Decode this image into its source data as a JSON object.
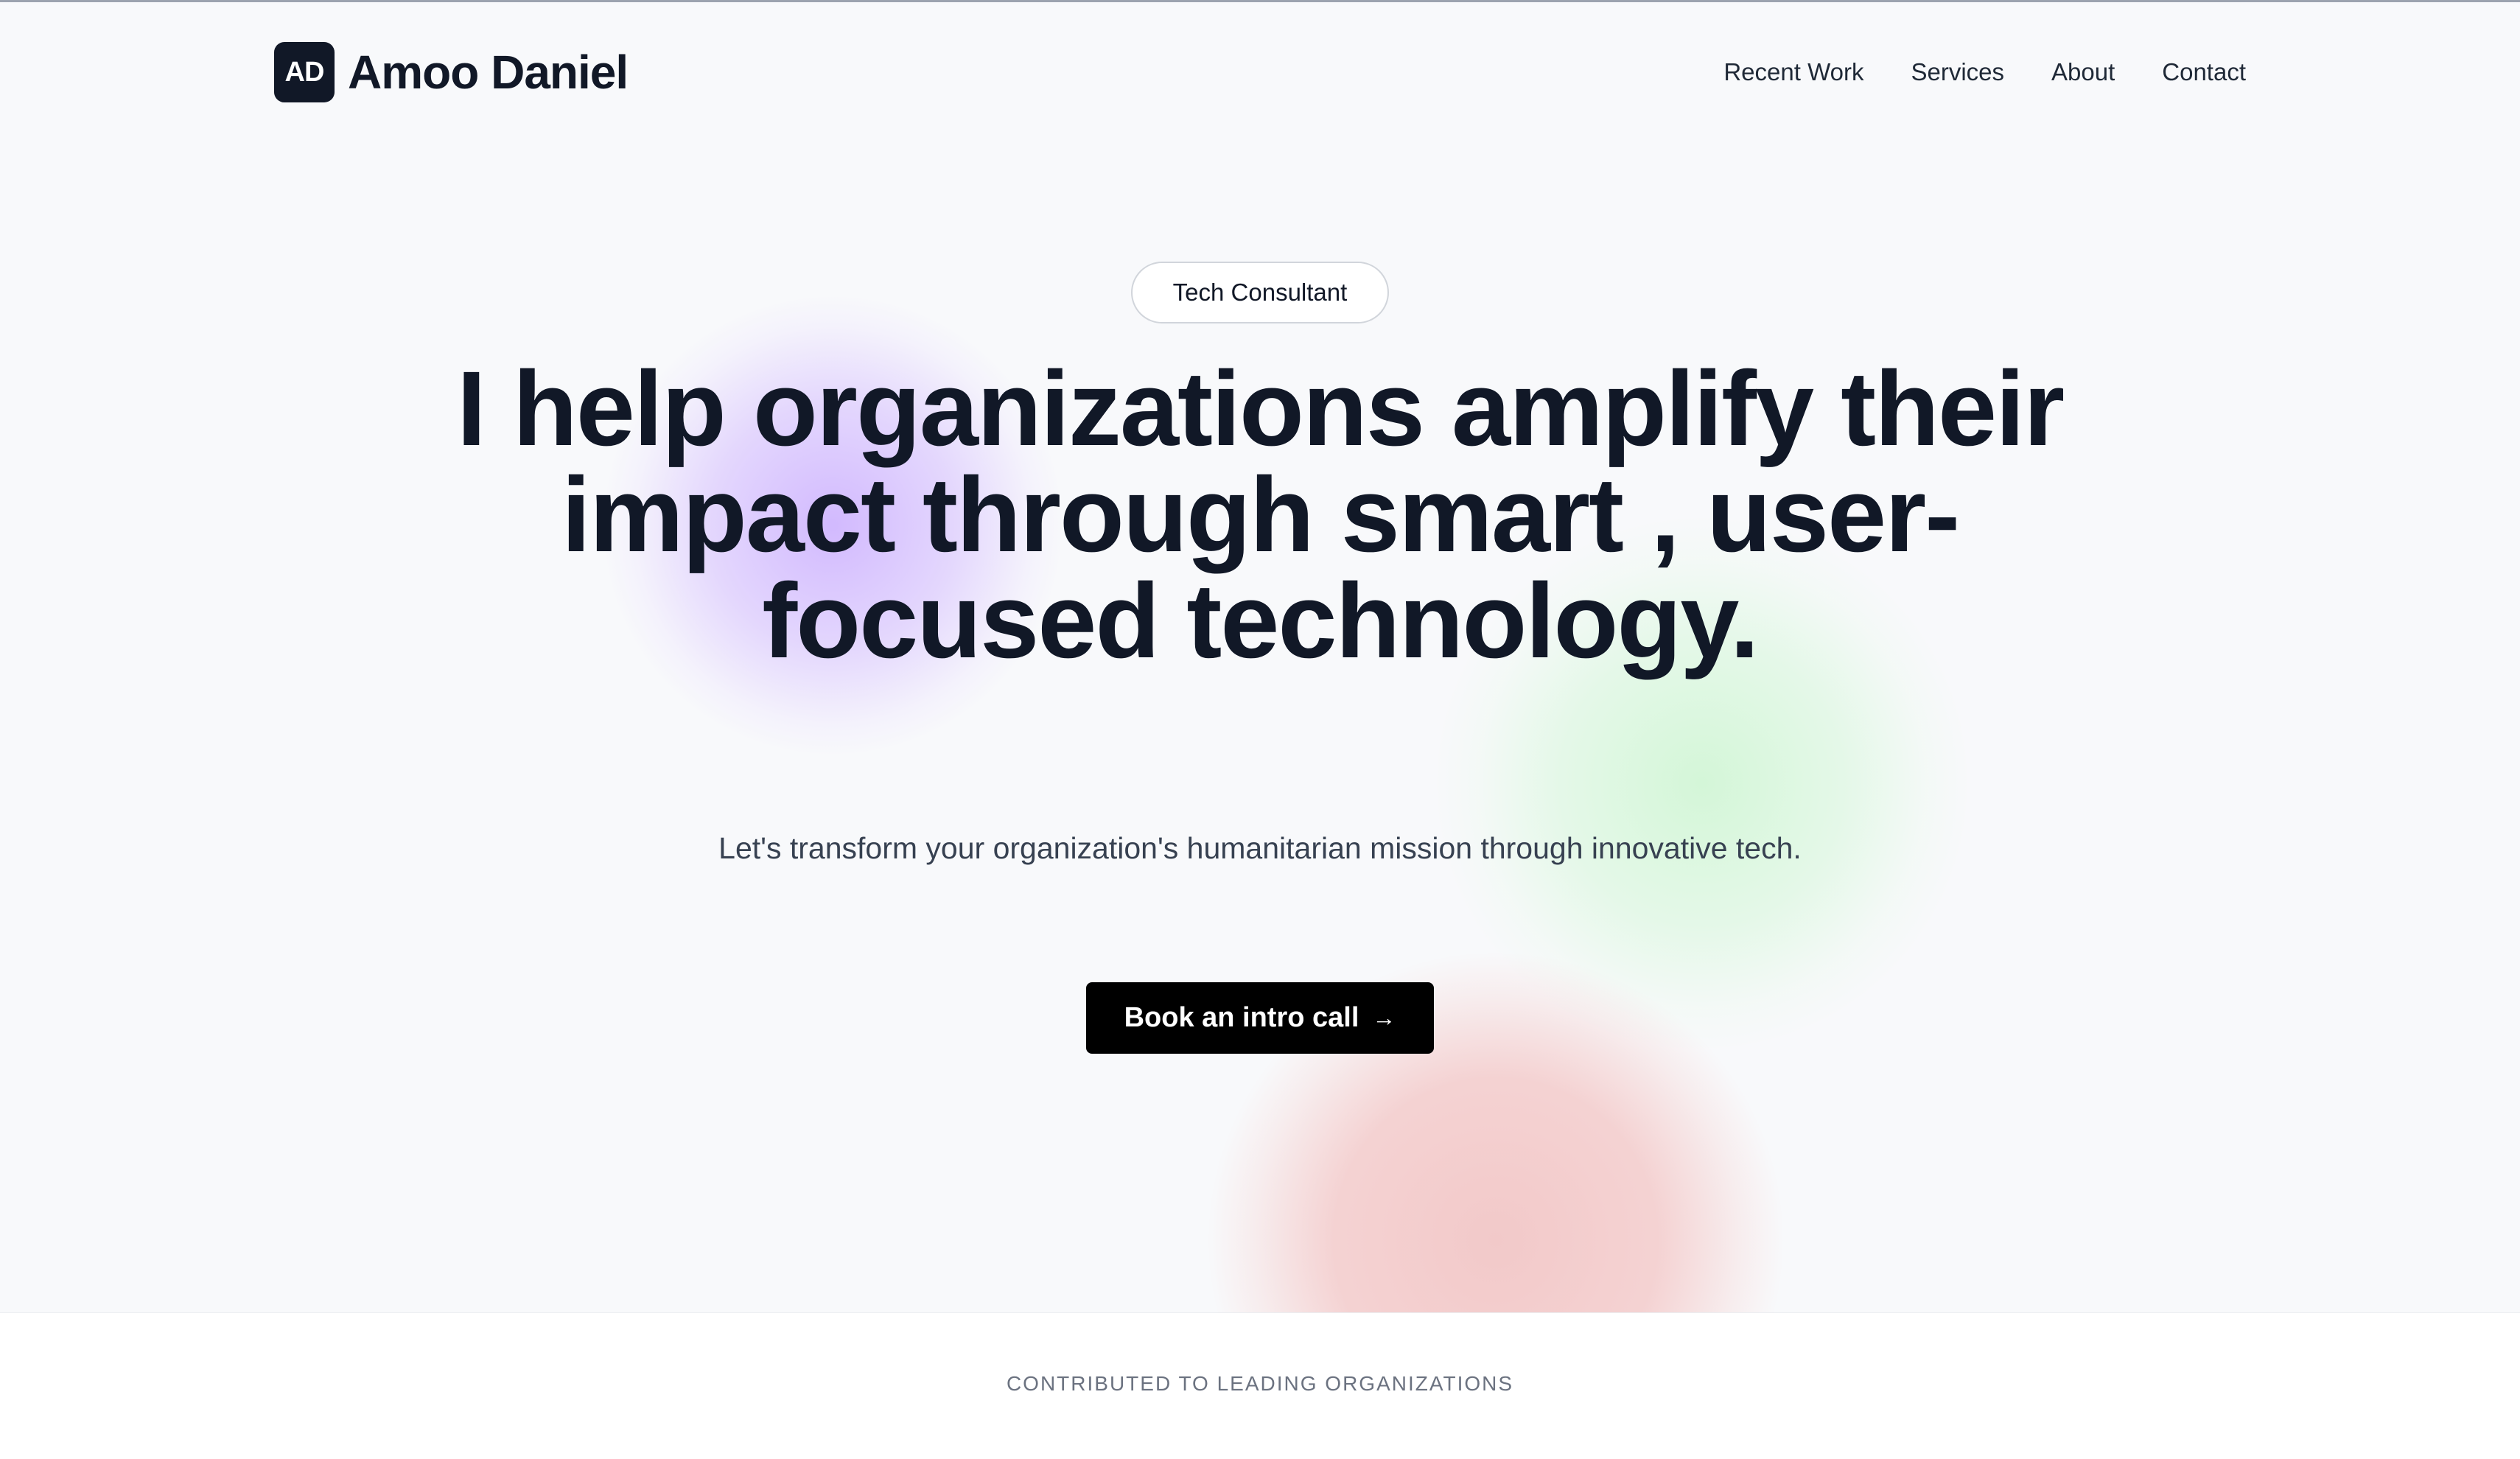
{
  "brand": {
    "logo_text": "AD",
    "name": "Amoo Daniel"
  },
  "nav": {
    "items": [
      {
        "label": "Recent Work"
      },
      {
        "label": "Services"
      },
      {
        "label": "About"
      },
      {
        "label": "Contact"
      }
    ]
  },
  "hero": {
    "badge": "Tech Consultant",
    "headline": "I help organizations amplify their impact through smart , user-focused technology.",
    "subtext": "Let's transform your organization's humanitarian mission through innovative tech.",
    "cta_label": "Book an intro call",
    "cta_icon": "arrow-right-icon",
    "blob_colors": {
      "purple": "#d9c5ff",
      "green": "#dcf5df",
      "pink": "#f3cfcf"
    }
  },
  "organizations": {
    "label": "CONTRIBUTED TO LEADING ORGANIZATIONS"
  }
}
